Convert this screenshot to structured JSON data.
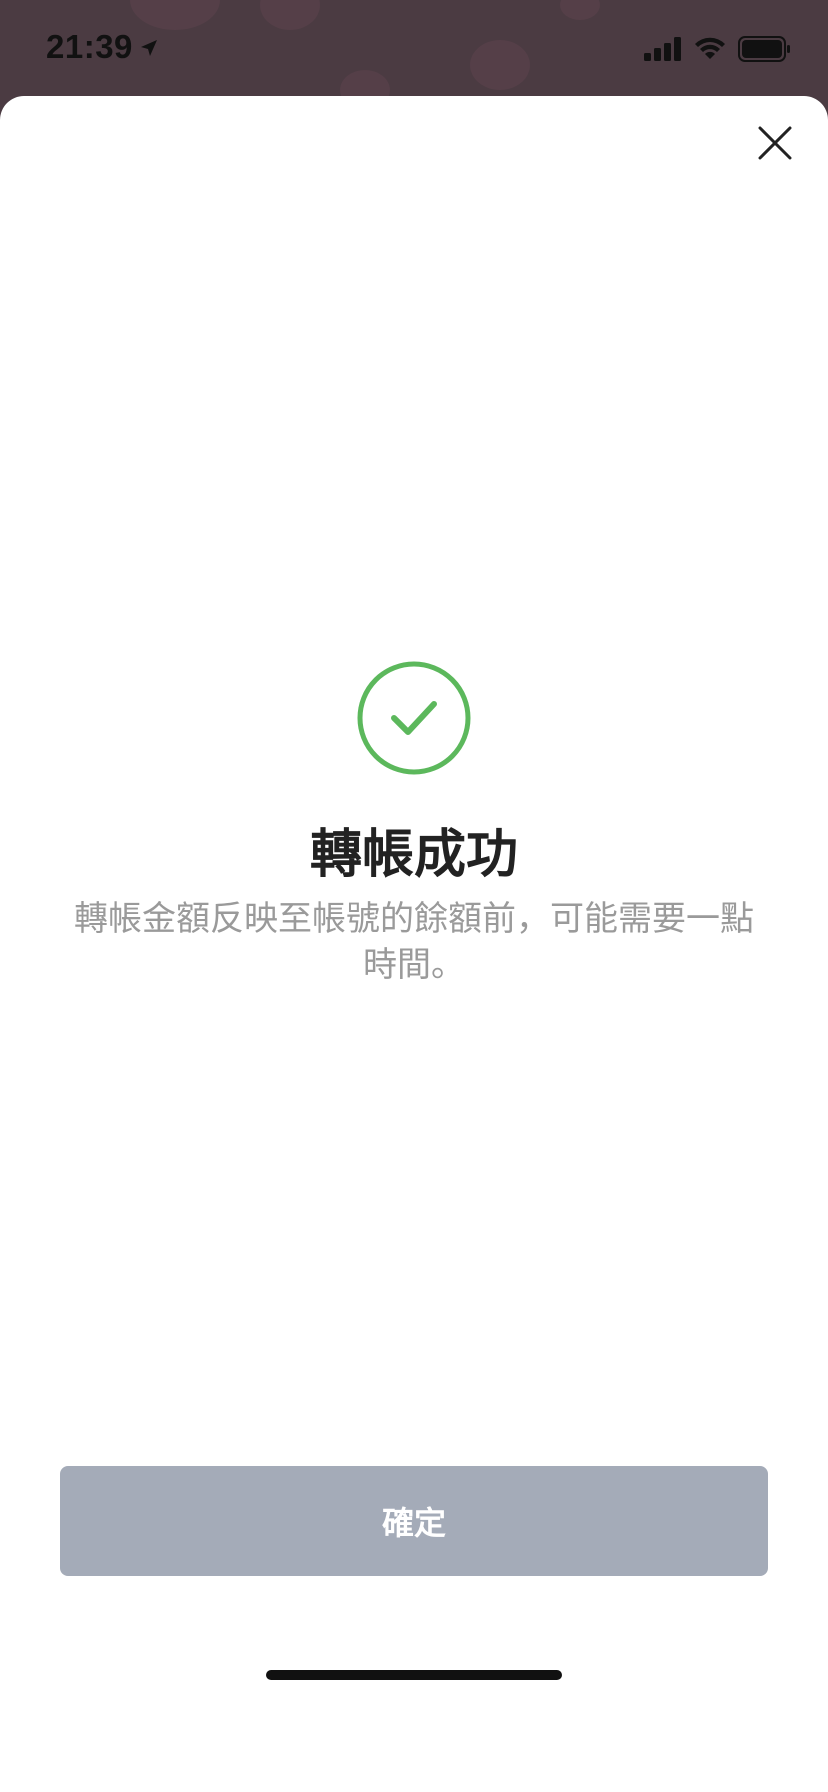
{
  "status_bar": {
    "time": "21:39",
    "location_icon": "location-arrow-icon",
    "signal_icon": "cellular-signal-icon",
    "wifi_icon": "wifi-icon",
    "battery_icon": "battery-icon"
  },
  "sheet": {
    "close_icon": "close-icon",
    "success_icon": "check-circle-icon",
    "title": "轉帳成功",
    "message": "轉帳金額反映至帳號的餘額前，可能需要一點時間。",
    "confirm_label": "確定"
  },
  "colors": {
    "success_green": "#5cb85c",
    "button_disabled_gray": "#a4abb8",
    "title_text": "#222222",
    "message_text": "#9a9a9a"
  }
}
